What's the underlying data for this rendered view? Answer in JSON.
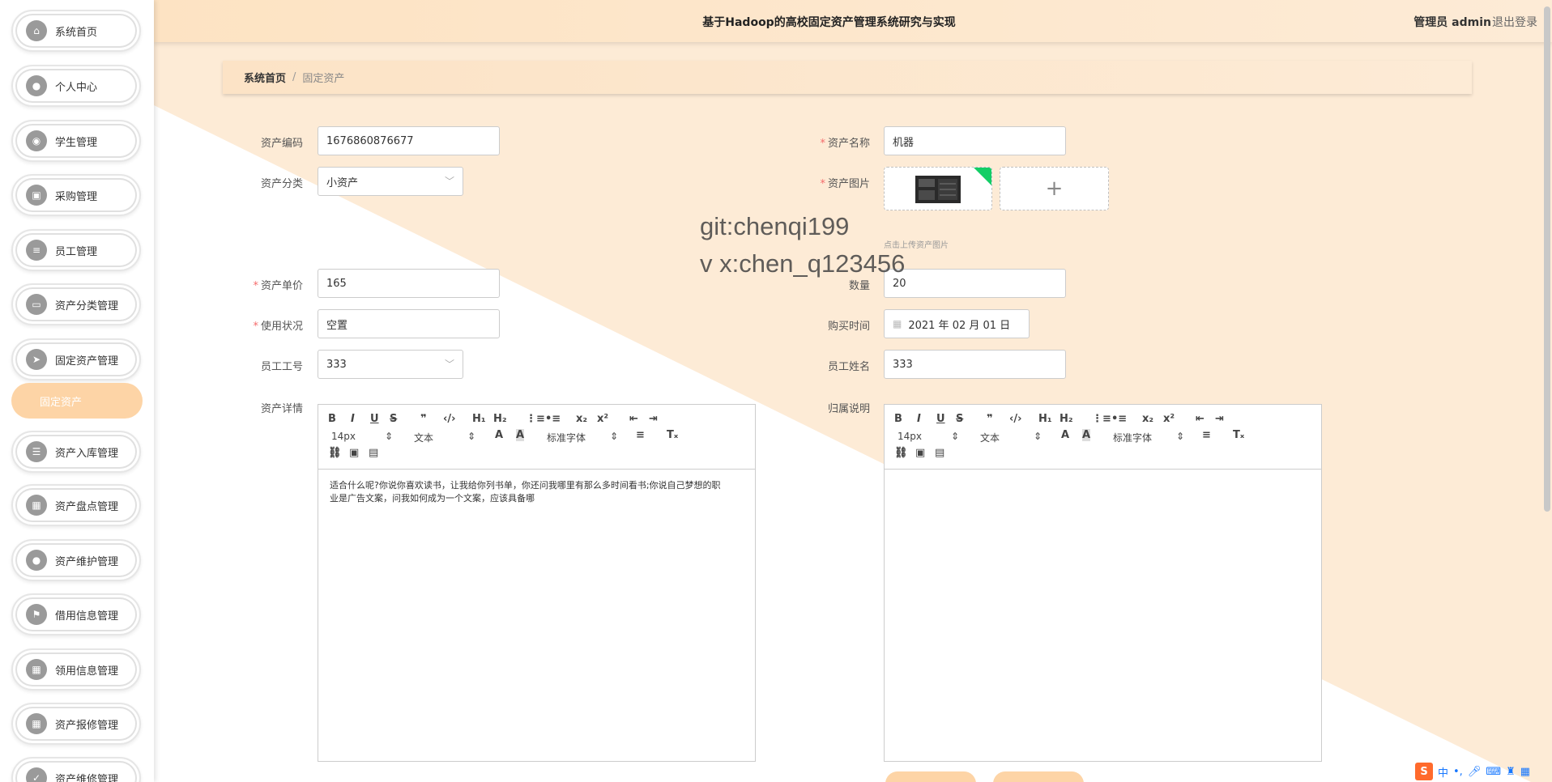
{
  "app": {
    "title": "基于Hadoop的高校固定资产管理系统研究与实现",
    "user_label": "管理员 admin",
    "logout_label": "退出登录"
  },
  "sidebar": {
    "items": [
      {
        "label": "系统首页",
        "icon": "home-icon"
      },
      {
        "label": "个人中心",
        "icon": "user-icon"
      },
      {
        "label": "学生管理",
        "icon": "location-icon"
      },
      {
        "label": "采购管理",
        "icon": "briefcase-icon"
      },
      {
        "label": "员工管理",
        "icon": "list-icon"
      },
      {
        "label": "资产分类管理",
        "icon": "folder-icon"
      },
      {
        "label": "固定资产管理",
        "icon": "send-icon"
      },
      {
        "label": "资产入库管理",
        "icon": "sliders-icon"
      },
      {
        "label": "资产盘点管理",
        "icon": "grid-icon"
      },
      {
        "label": "资产维护管理",
        "icon": "user-icon"
      },
      {
        "label": "借用信息管理",
        "icon": "flag-icon"
      },
      {
        "label": "领用信息管理",
        "icon": "grid-icon"
      },
      {
        "label": "资产报修管理",
        "icon": "grid-icon"
      },
      {
        "label": "资产维修管理",
        "icon": "check-icon"
      }
    ],
    "submenu_active": "固定资产"
  },
  "breadcrumb": {
    "home": "系统首页",
    "sep": "/",
    "current": "固定资产"
  },
  "form": {
    "asset_code": {
      "label": "资产编码",
      "value": "1676860876677"
    },
    "asset_name": {
      "label": "资产名称",
      "value": "机器"
    },
    "asset_category": {
      "label": "资产分类",
      "value": "小资产"
    },
    "asset_image": {
      "label": "资产图片",
      "hint": "点击上传资产图片"
    },
    "unit_price": {
      "label": "资产单价",
      "value": "165"
    },
    "quantity": {
      "label": "数量",
      "value": "20"
    },
    "usage_status": {
      "label": "使用状况",
      "value": "空置"
    },
    "purchase_date": {
      "label": "购买时间",
      "value": "2021 年 02 月 01 日"
    },
    "employee_no": {
      "label": "员工工号",
      "value": "333"
    },
    "employee_name": {
      "label": "员工姓名",
      "value": "333"
    },
    "asset_detail": {
      "label": "资产详情",
      "content": "适合什么呢?你说你喜欢读书，让我给你列书单，你还问我哪里有那么多时间看书;你说自己梦想的职业是广告文案，问我如何成为一个文案，应该具备哪"
    },
    "ownership_desc": {
      "label": "归属说明",
      "content": ""
    }
  },
  "editor_toolbar": {
    "font_size": "14px",
    "text_style": "文本",
    "font_family": "标准字体"
  },
  "watermark": {
    "line1": "git:chenqi199",
    "line2": "v x:chen_q123456"
  },
  "tray": {
    "ime": "中"
  },
  "colors": {
    "accent": "#fdd4a6",
    "header_bg": "#fde3c3",
    "required": "#f56c6c",
    "upload_badge": "#13ce66"
  }
}
